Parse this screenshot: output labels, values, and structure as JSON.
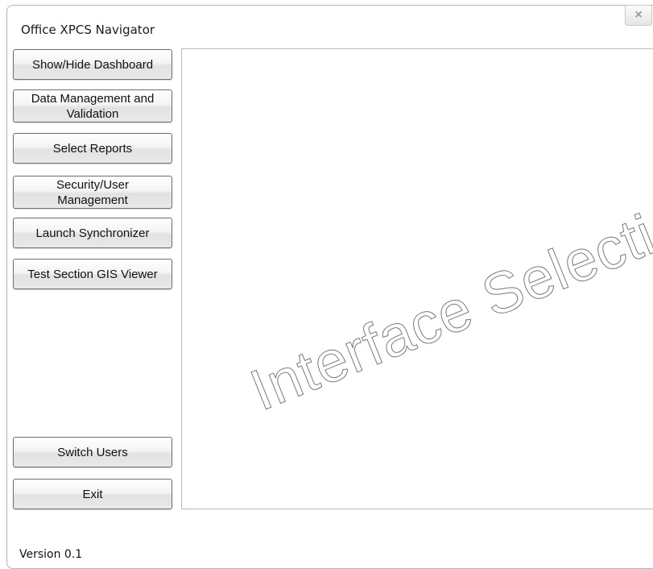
{
  "window": {
    "title": "Office XPCS Navigator",
    "close_label": "×"
  },
  "nav": {
    "show_hide_dashboard": "Show/Hide Dashboard",
    "data_management": "Data Management and\nValidation",
    "select_reports": "Select Reports",
    "security_user_management": "Security/User\nManagement",
    "launch_synchronizer": "Launch Synchronizer",
    "test_section_gis_viewer": "Test Section GIS Viewer",
    "switch_users": "Switch Users",
    "exit": "Exit"
  },
  "content": {
    "watermark": "Interface Selections"
  },
  "footer": {
    "version": "Version 0.1"
  }
}
